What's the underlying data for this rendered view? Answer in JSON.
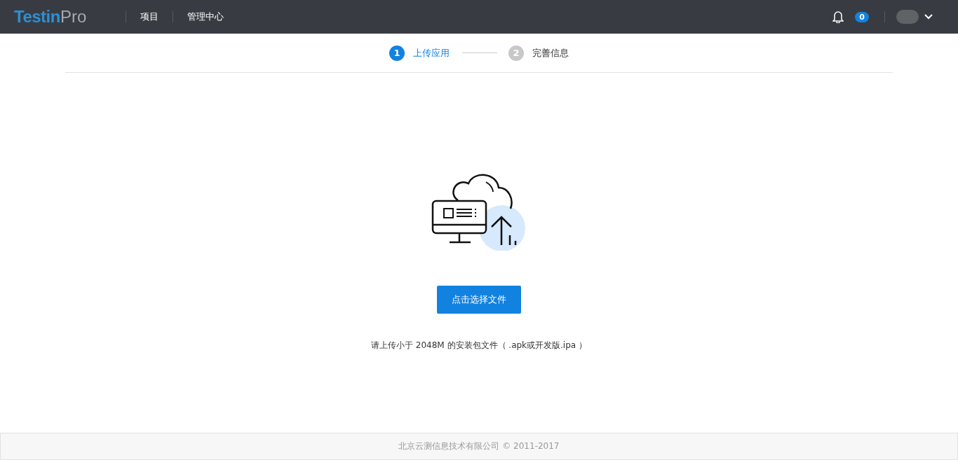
{
  "header": {
    "logo": {
      "main": "Testin",
      "suffix": "Pro"
    },
    "nav": [
      {
        "label": "项目"
      },
      {
        "label": "管理中心"
      }
    ],
    "notification_count": "0"
  },
  "steps": [
    {
      "number": "1",
      "label": "上传应用",
      "selected": true
    },
    {
      "number": "2",
      "label": "完善信息",
      "selected": false
    }
  ],
  "upload": {
    "button": "点击选择文件",
    "hint": "请上传小于 2048M 的安装包文件（ .apk或开发版.ipa ）"
  },
  "footer": "北京云测信息技术有限公司 © 2011-2017"
}
